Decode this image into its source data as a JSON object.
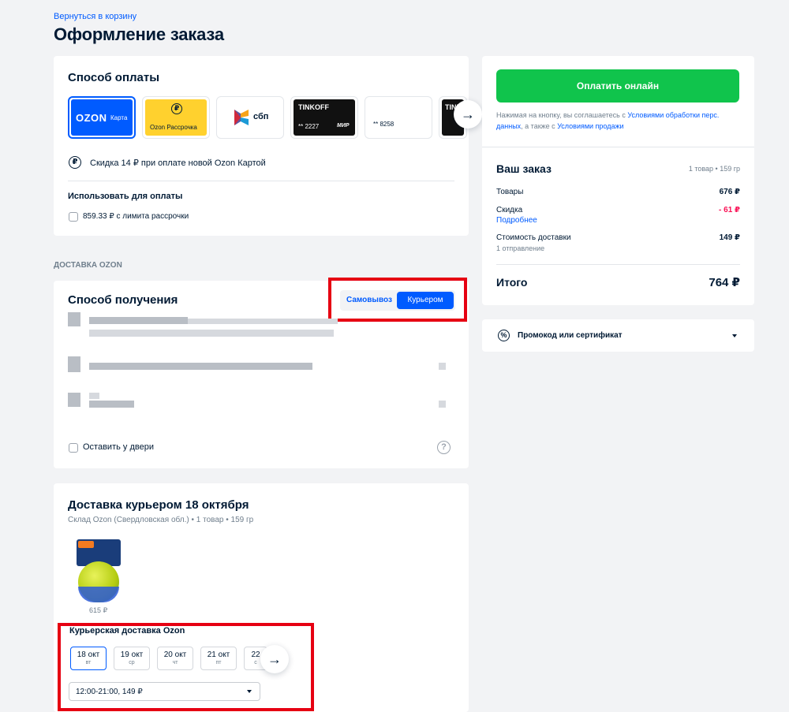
{
  "header": {
    "back_link": "Вернуться в корзину",
    "title": "Оформление заказа"
  },
  "payment": {
    "title": "Способ оплаты",
    "methods": [
      {
        "brand": "OZON",
        "label": "Карта",
        "selected": true,
        "color": "#005bff"
      },
      {
        "label": "Ozon Рассрочка",
        "color": "#ffd12e"
      },
      {
        "label": "сбп"
      },
      {
        "brand": "TINKOFF",
        "masked": "** 2227",
        "network": "МИР",
        "color": "#111111"
      },
      {
        "masked": "** 8258"
      },
      {
        "brand": "TINKOFF",
        "color": "#111111"
      }
    ],
    "discount_text": "Скидка 14 ₽ при оплате новой Ozon Картой",
    "use_label": "Использовать для оплаты",
    "installment_option": "859.33 ₽ с лимита рассрочки"
  },
  "delivery_section_label": "ДОСТАВКА OZON",
  "receiving": {
    "title": "Способ получения",
    "options": [
      "Самовывоз",
      "Курьером"
    ],
    "selected_option": "Курьером",
    "leave_at_door": "Оставить у двери"
  },
  "courier": {
    "title": "Доставка курьером 18 октября",
    "subtitle": "Склад Ozon (Свердловская обл.) • 1 товар • 159 гр",
    "product_price": "615 ₽",
    "section_title": "Курьерская доставка Ozon",
    "dates": [
      {
        "day": "18 окт",
        "weekday": "вт",
        "selected": true
      },
      {
        "day": "19 окт",
        "weekday": "ср"
      },
      {
        "day": "20 окт",
        "weekday": "чт"
      },
      {
        "day": "21 окт",
        "weekday": "пт"
      },
      {
        "day": "22",
        "weekday": "с"
      }
    ],
    "time_slot": "12:00-21:00, 149 ₽"
  },
  "summary": {
    "pay_button": "Оплатить онлайн",
    "consent_prefix": "Нажимая на кнопку, вы соглашаетесь с",
    "consent_link1": "Условиями обработки перс. данных",
    "consent_middle": ", а также с",
    "consent_link2": "Условиями продажи",
    "order_title": "Ваш заказ",
    "order_meta": "1 товар • 159 гр",
    "goods_label": "Товары",
    "goods_value": "676 ₽",
    "discount_label": "Скидка",
    "discount_link": "Подробнее",
    "discount_value": "- 61 ₽",
    "shipping_label": "Стоимость доставки",
    "shipping_sub": "1 отправление",
    "shipping_value": "149 ₽",
    "total_label": "Итого",
    "total_value": "764 ₽",
    "promo_label": "Промокод или сертификат"
  },
  "colors": {
    "accent": "#005bff",
    "pay_button": "#10c44c",
    "discount": "#f91155",
    "highlight": "#e60012"
  }
}
